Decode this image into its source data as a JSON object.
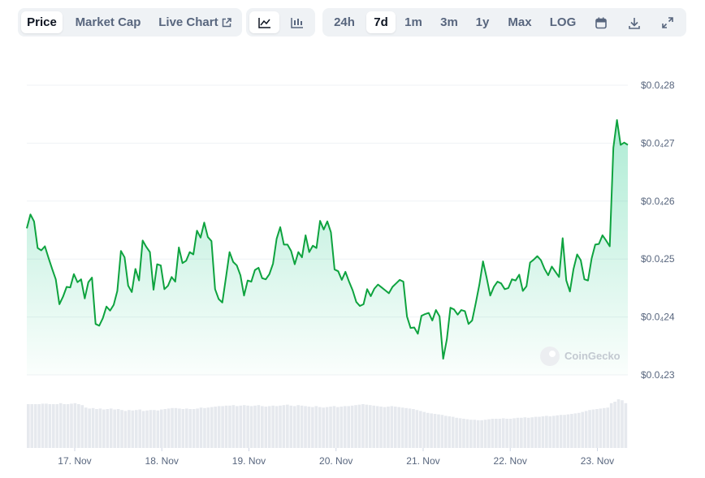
{
  "toolbar": {
    "price_label": "Price",
    "market_cap_label": "Market Cap",
    "live_chart_label": "Live Chart",
    "ranges": [
      "24h",
      "7d",
      "1m",
      "3m",
      "1y",
      "Max",
      "LOG"
    ],
    "active_range": "7d"
  },
  "watermark": "CoinGecko",
  "colors": {
    "line": "#16c784",
    "line_stroke": "#0ea33f",
    "volume": "#e6e9ee"
  },
  "chart_data": {
    "type": "line",
    "title": "",
    "xlabel": "",
    "ylabel": "",
    "x_tick_labels": [
      "17. Nov",
      "18. Nov",
      "19. Nov",
      "20. Nov",
      "21. Nov",
      "22. Nov",
      "23. Nov"
    ],
    "x_range_days": [
      16.45,
      23.35
    ],
    "y_tick_labels": [
      "$0.0₄23",
      "$0.0₄24",
      "$0.0₄25",
      "$0.0₄26",
      "$0.0₄27",
      "$0.0₄28"
    ],
    "ylim": [
      2.3,
      2.8
    ],
    "y_unit": "× 10⁻⁵ USD",
    "grid": true,
    "series": [
      {
        "values": [
          2.553,
          2.577,
          2.565,
          2.519,
          2.515,
          2.522,
          2.502,
          2.483,
          2.465,
          2.422,
          2.435,
          2.452,
          2.451,
          2.474,
          2.46,
          2.465,
          2.432,
          2.46,
          2.468,
          2.388,
          2.385,
          2.398,
          2.418,
          2.411,
          2.421,
          2.445,
          2.514,
          2.503,
          2.454,
          2.443,
          2.483,
          2.463,
          2.532,
          2.521,
          2.512,
          2.447,
          2.491,
          2.489,
          2.448,
          2.454,
          2.469,
          2.461,
          2.52,
          2.493,
          2.497,
          2.512,
          2.508,
          2.549,
          2.537,
          2.563,
          2.538,
          2.531,
          2.448,
          2.431,
          2.425,
          2.468,
          2.512,
          2.495,
          2.489,
          2.472,
          2.437,
          2.463,
          2.461,
          2.481,
          2.485,
          2.467,
          2.465,
          2.474,
          2.492,
          2.535,
          2.555,
          2.525,
          2.525,
          2.514,
          2.491,
          2.512,
          2.503,
          2.541,
          2.512,
          2.523,
          2.519,
          2.566,
          2.551,
          2.565,
          2.546,
          2.482,
          2.479,
          2.464,
          2.478,
          2.461,
          2.446,
          2.426,
          2.419,
          2.422,
          2.448,
          2.436,
          2.449,
          2.456,
          2.451,
          2.446,
          2.441,
          2.452,
          2.458,
          2.464,
          2.461,
          2.401,
          2.381,
          2.382,
          2.371,
          2.402,
          2.405,
          2.407,
          2.394,
          2.412,
          2.401,
          2.328,
          2.361,
          2.416,
          2.413,
          2.404,
          2.412,
          2.41,
          2.388,
          2.394,
          2.424,
          2.456,
          2.496,
          2.468,
          2.437,
          2.452,
          2.461,
          2.458,
          2.448,
          2.45,
          2.465,
          2.463,
          2.473,
          2.445,
          2.453,
          2.494,
          2.499,
          2.505,
          2.498,
          2.483,
          2.472,
          2.487,
          2.478,
          2.469,
          2.536,
          2.463,
          2.444,
          2.483,
          2.508,
          2.498,
          2.465,
          2.463,
          2.501,
          2.525,
          2.526,
          2.541,
          2.532,
          2.522,
          2.692,
          2.74,
          2.697,
          2.701,
          2.697
        ]
      }
    ],
    "volume": [
      0.9,
      0.9,
      0.9,
      0.9,
      0.91,
      0.91,
      0.9,
      0.9,
      0.9,
      0.92,
      0.9,
      0.9,
      0.91,
      0.92,
      0.9,
      0.88,
      0.83,
      0.81,
      0.82,
      0.8,
      0.81,
      0.79,
      0.8,
      0.81,
      0.79,
      0.8,
      0.78,
      0.76,
      0.78,
      0.77,
      0.78,
      0.79,
      0.76,
      0.77,
      0.78,
      0.78,
      0.77,
      0.79,
      0.8,
      0.81,
      0.82,
      0.82,
      0.81,
      0.8,
      0.81,
      0.8,
      0.8,
      0.81,
      0.83,
      0.82,
      0.83,
      0.84,
      0.85,
      0.86,
      0.86,
      0.87,
      0.87,
      0.88,
      0.86,
      0.87,
      0.88,
      0.87,
      0.86,
      0.87,
      0.88,
      0.86,
      0.85,
      0.86,
      0.87,
      0.86,
      0.87,
      0.88,
      0.89,
      0.87,
      0.86,
      0.88,
      0.87,
      0.86,
      0.85,
      0.84,
      0.86,
      0.84,
      0.83,
      0.84,
      0.85,
      0.86,
      0.84,
      0.85,
      0.86,
      0.86,
      0.87,
      0.88,
      0.89,
      0.9,
      0.89,
      0.88,
      0.87,
      0.86,
      0.85,
      0.84,
      0.85,
      0.86,
      0.85,
      0.84,
      0.83,
      0.82,
      0.81,
      0.8,
      0.78,
      0.76,
      0.74,
      0.72,
      0.71,
      0.7,
      0.69,
      0.68,
      0.66,
      0.65,
      0.64,
      0.62,
      0.61,
      0.6,
      0.59,
      0.58,
      0.58,
      0.57,
      0.57,
      0.58,
      0.59,
      0.6,
      0.6,
      0.6,
      0.61,
      0.6,
      0.6,
      0.61,
      0.62,
      0.62,
      0.63,
      0.62,
      0.63,
      0.64,
      0.64,
      0.65,
      0.66,
      0.65,
      0.66,
      0.67,
      0.68,
      0.68,
      0.69,
      0.7,
      0.71,
      0.72,
      0.74,
      0.76,
      0.78,
      0.79,
      0.8,
      0.81,
      0.82,
      0.83,
      0.92,
      0.95,
      1.0,
      0.98,
      0.92
    ]
  }
}
